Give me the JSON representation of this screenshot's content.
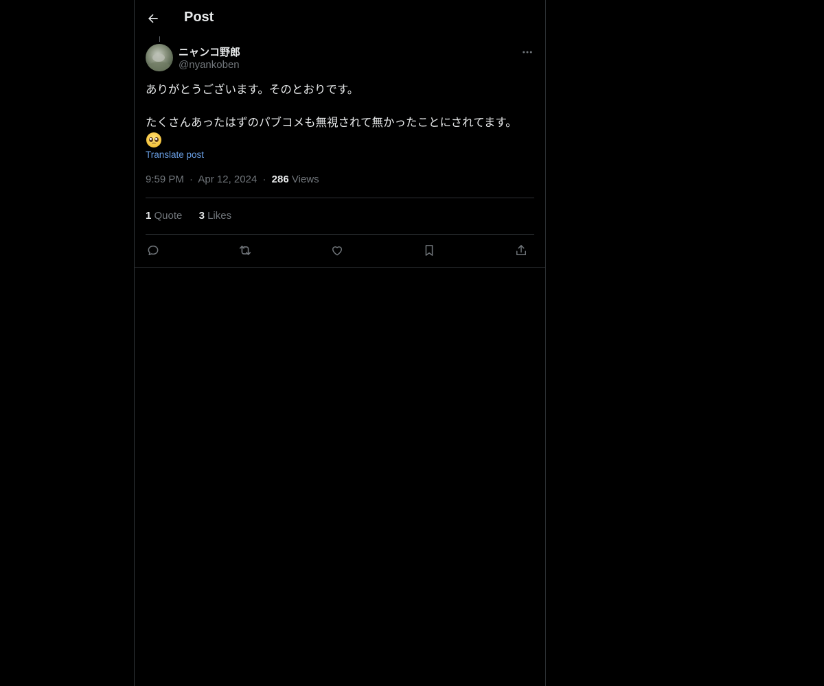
{
  "header": {
    "title": "Post",
    "back_icon": "arrow-left-icon"
  },
  "post": {
    "author_name": "ニャンコ野郎",
    "author_handle": "@nyankoben",
    "text": "ありがとうございます。そのとおりです。\n\nたくさんあったはずのパブコメも無視されて無かったことにされてます。",
    "emoji": "pleading-face-icon",
    "translate_label": "Translate post",
    "time": "9:59 PM",
    "date": "Apr 12, 2024",
    "views_count": "286",
    "views_label": "Views",
    "separator": "·"
  },
  "stats": {
    "quotes_count": "1",
    "quotes_label": "Quote",
    "likes_count": "3",
    "likes_label": "Likes"
  },
  "actions": [
    "reply-icon",
    "repost-icon",
    "like-icon",
    "bookmark-icon",
    "share-icon"
  ],
  "colors": {
    "background": "#000000",
    "text": "#e7e9ea",
    "muted": "#71767b",
    "link": "#6aa0e6",
    "border": "#2f3336"
  }
}
